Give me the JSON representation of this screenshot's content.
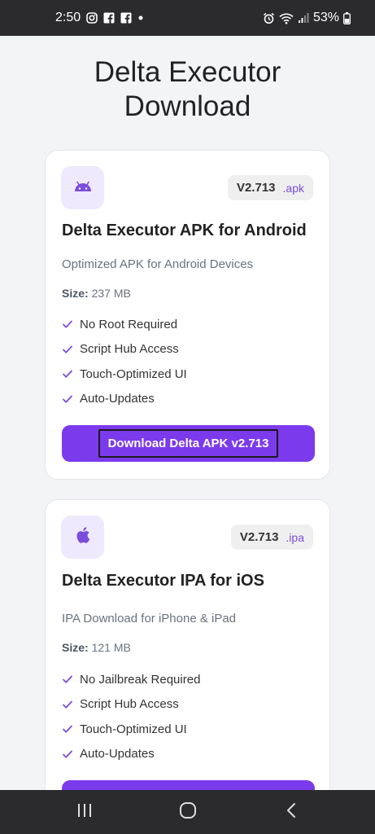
{
  "status_bar": {
    "time": "2:50",
    "battery": "53%"
  },
  "page": {
    "title_line1": "Delta Executor",
    "title_line2": "Download"
  },
  "cards": [
    {
      "version": "V2.713",
      "extension": ".apk",
      "title": "Delta Executor APK for Android",
      "subtitle": "Optimized APK for Android Devices",
      "size_label": "Size:",
      "size_value": "237 MB",
      "features": [
        "No Root Required",
        "Script Hub Access",
        "Touch-Optimized UI",
        "Auto-Updates"
      ],
      "button_label": "Download Delta APK v2.713",
      "icon": "android-icon"
    },
    {
      "version": "V2.713",
      "extension": ".ipa",
      "title": "Delta Executor IPA for iOS",
      "subtitle": "IPA Download for iPhone & iPad",
      "size_label": "Size:",
      "size_value": "121 MB",
      "features": [
        "No Jailbreak Required",
        "Script Hub Access",
        "Touch-Optimized UI",
        "Auto-Updates"
      ],
      "icon": "apple-icon"
    }
  ],
  "colors": {
    "accent": "#7c3aed",
    "badge_bg": "#efe9fd",
    "check": "#7c4ddb"
  }
}
